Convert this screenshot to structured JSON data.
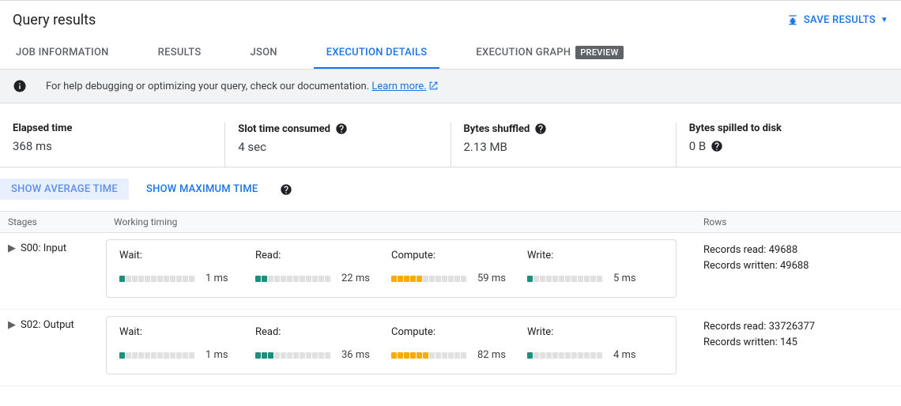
{
  "header": {
    "title": "Query results",
    "save_button": "SAVE RESULTS"
  },
  "tabs": [
    {
      "label": "JOB INFORMATION",
      "active": false
    },
    {
      "label": "RESULTS",
      "active": false
    },
    {
      "label": "JSON",
      "active": false
    },
    {
      "label": "EXECUTION DETAILS",
      "active": true
    },
    {
      "label": "EXECUTION GRAPH",
      "active": false,
      "badge": "PREVIEW"
    }
  ],
  "info_bar": {
    "text_prefix": "For help debugging or optimizing your query, check our documentation. ",
    "link_text": "Learn more."
  },
  "stats": {
    "elapsed": {
      "label": "Elapsed time",
      "value": "368 ms"
    },
    "slot": {
      "label": "Slot time consumed",
      "value": "4 sec"
    },
    "shuffled": {
      "label": "Bytes shuffled",
      "value": "2.13 MB"
    },
    "spilled": {
      "label": "Bytes spilled to disk",
      "value": "0 B"
    }
  },
  "toggles": {
    "avg": "SHOW AVERAGE TIME",
    "max": "SHOW MAXIMUM TIME"
  },
  "table_head": {
    "stages": "Stages",
    "timing": "Working timing",
    "rows": "Rows"
  },
  "timing_labels": {
    "wait": "Wait:",
    "read": "Read:",
    "compute": "Compute:",
    "write": "Write:"
  },
  "stages": [
    {
      "name": "S00: Input",
      "wait": {
        "value": "1 ms",
        "filled": 1,
        "color": "teal"
      },
      "read": {
        "value": "22 ms",
        "filled": 2,
        "color": "teal"
      },
      "compute": {
        "value": "59 ms",
        "filled": 5,
        "color": "amber"
      },
      "write": {
        "value": "5 ms",
        "filled": 1,
        "color": "teal"
      },
      "records_read": "Records read: 49688",
      "records_written": "Records written: 49688"
    },
    {
      "name": "S02: Output",
      "wait": {
        "value": "1 ms",
        "filled": 1,
        "color": "teal"
      },
      "read": {
        "value": "36 ms",
        "filled": 3,
        "color": "teal"
      },
      "compute": {
        "value": "82 ms",
        "filled": 6,
        "color": "amber"
      },
      "write": {
        "value": "4 ms",
        "filled": 1,
        "color": "teal"
      },
      "records_read": "Records read: 33726377",
      "records_written": "Records written: 145"
    }
  ]
}
